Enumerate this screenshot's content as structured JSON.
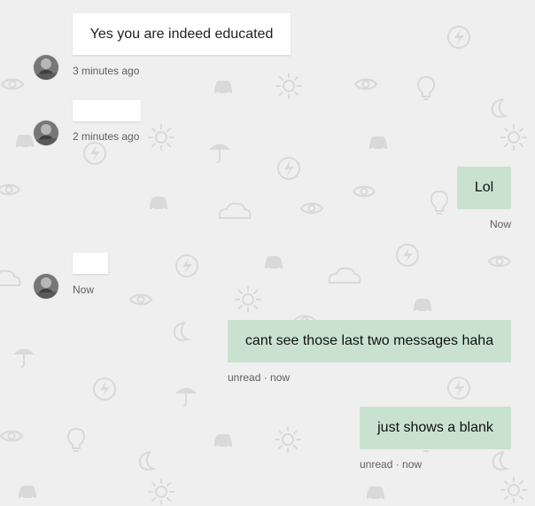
{
  "colors": {
    "background": "#efefef",
    "incoming_bubble": "#ffffff",
    "outgoing_bubble": "#c9e2cf",
    "meta_text": "#5f5f5f",
    "pattern_icon": "#d9d9d9"
  },
  "icons": {
    "avatar": "avatar-photo-icon",
    "pattern": [
      "eye-icon",
      "car-icon",
      "sun-icon",
      "bolt-icon",
      "umbrella-icon",
      "cloud-icon",
      "lightbulb-icon",
      "moon-icon"
    ]
  },
  "messages": [
    {
      "direction": "incoming",
      "text": "Yes you are indeed educated",
      "meta": "3 minutes ago"
    },
    {
      "direction": "incoming",
      "text": "",
      "meta": "2 minutes ago"
    },
    {
      "direction": "outgoing",
      "text": "Lol",
      "meta": "Now"
    },
    {
      "direction": "incoming",
      "text": "",
      "meta": "Now"
    },
    {
      "direction": "outgoing",
      "text": "cant see those last two messages haha",
      "meta": "unread · now"
    },
    {
      "direction": "outgoing",
      "text": "just shows a blank",
      "meta": "unread · now"
    }
  ]
}
